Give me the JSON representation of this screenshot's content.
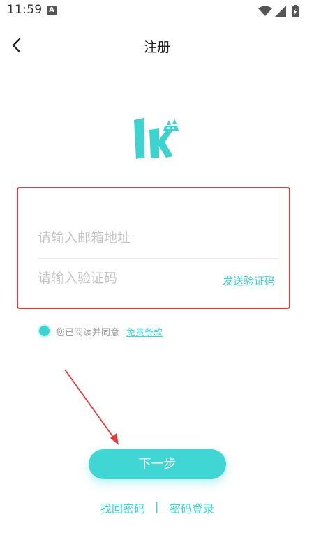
{
  "status_bar": {
    "time": "11:59",
    "icons": [
      "a-notification-icon",
      "wifi-icon",
      "signal-icon",
      "battery-icon"
    ]
  },
  "header": {
    "title": "注册",
    "back_icon": "chevron-left-icon"
  },
  "logo": {
    "name": "app-logo",
    "color": "#3dd3d0"
  },
  "form": {
    "email": {
      "value": "",
      "placeholder": "请输入邮箱地址"
    },
    "code": {
      "value": "",
      "placeholder": "请输入验证码"
    },
    "send_code_label": "发送验证码"
  },
  "agreement": {
    "text": "您已阅读并同意",
    "link": "免责条款",
    "checked": true
  },
  "next_button_label": "下一步",
  "bottom_links": {
    "find_password": "找回密码",
    "separator": "|",
    "password_login": "密码登录"
  },
  "colors": {
    "accent": "#3dd3d0",
    "annotation": "#e53a3a"
  }
}
